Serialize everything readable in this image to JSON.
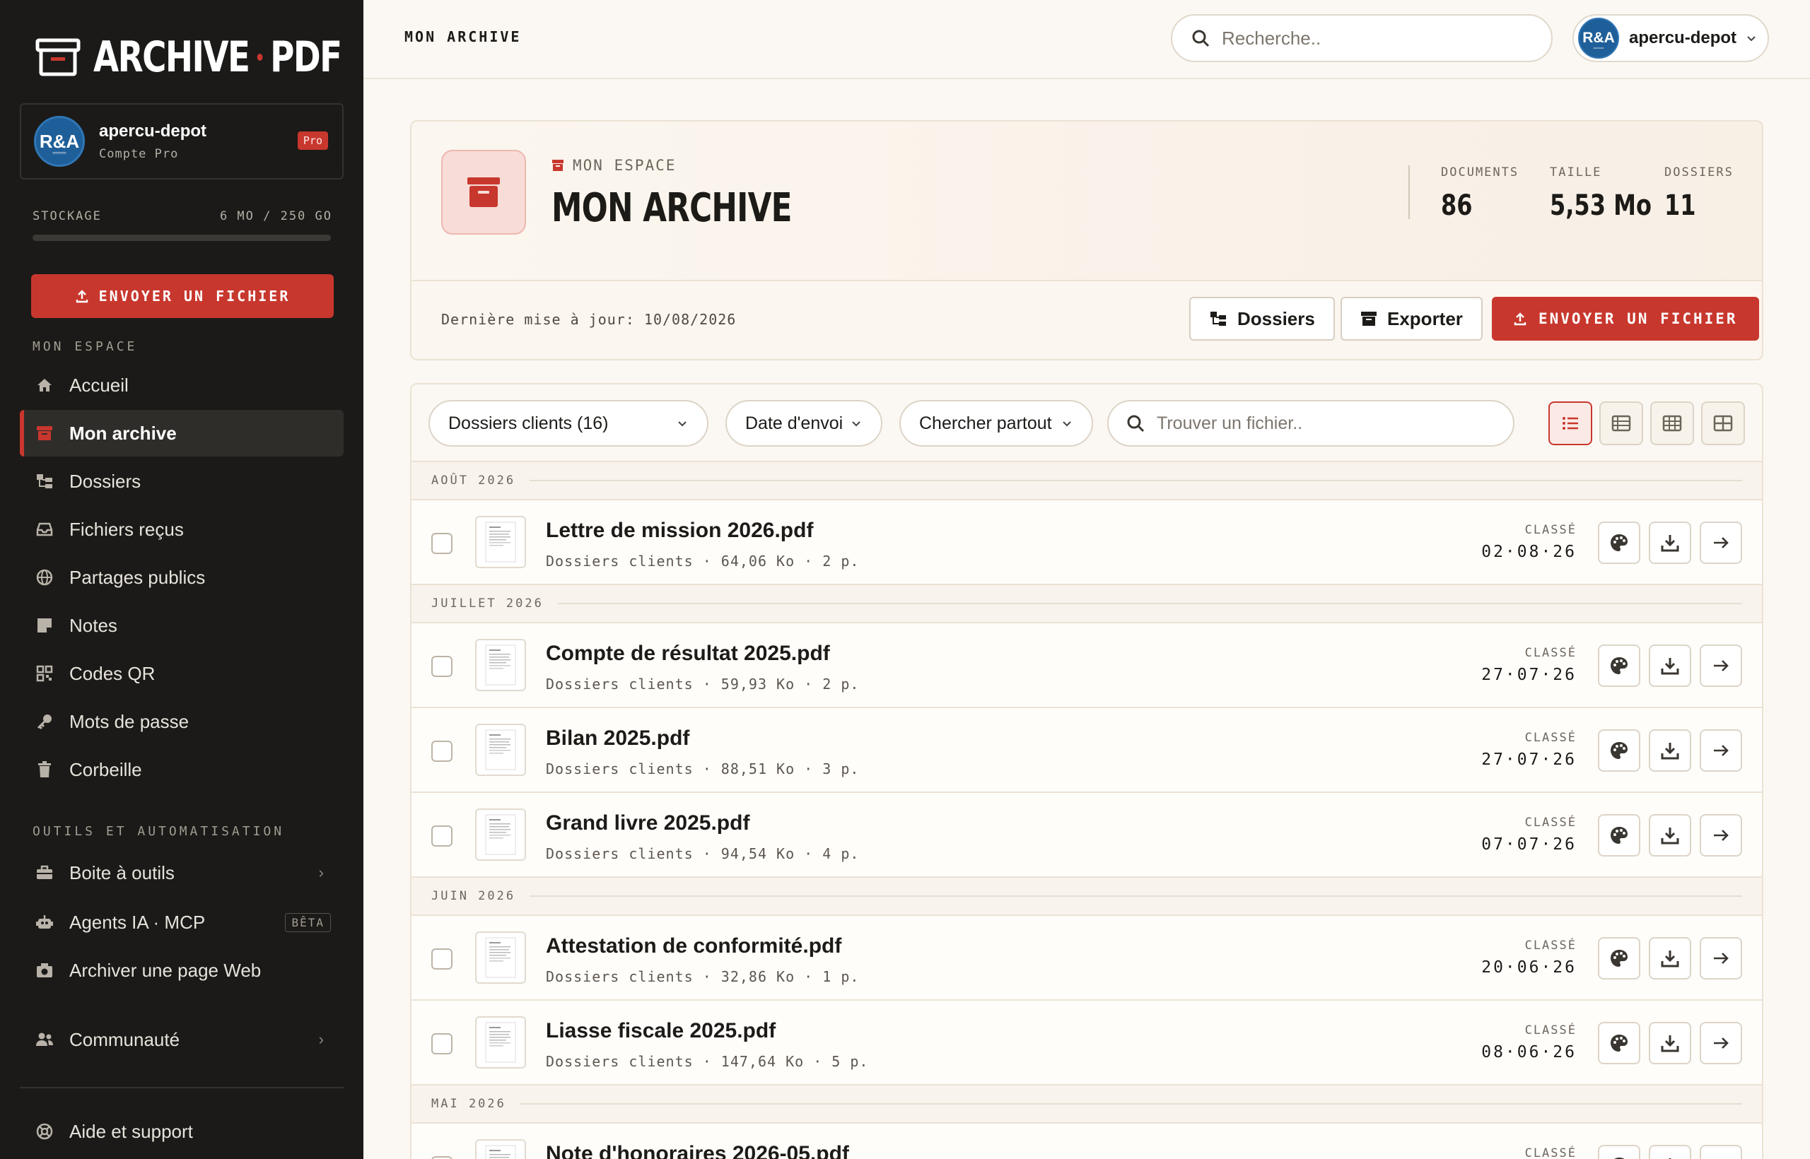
{
  "brand": {
    "name_left": "ARCHIVE",
    "name_right": "PDF"
  },
  "account": {
    "initials": "R&A",
    "name": "apercu-depot",
    "plan": "Compte Pro",
    "badge": "Pro"
  },
  "storage": {
    "label": "STOCKAGE",
    "value": "6 MO / 250 GO",
    "used_fraction": 2e-05
  },
  "sidebar": {
    "upload_label": "ENVOYER UN FICHIER",
    "section1": "MON ESPACE",
    "items": [
      {
        "label": "Accueil",
        "icon": "home-icon"
      },
      {
        "label": "Mon archive",
        "icon": "archive-icon",
        "active": true
      },
      {
        "label": "Dossiers",
        "icon": "folder-tree-icon"
      },
      {
        "label": "Fichiers reçus",
        "icon": "inbox-icon"
      },
      {
        "label": "Partages publics",
        "icon": "globe-icon"
      },
      {
        "label": "Notes",
        "icon": "note-icon"
      },
      {
        "label": "Codes QR",
        "icon": "qr-icon"
      },
      {
        "label": "Mots de passe",
        "icon": "key-icon"
      },
      {
        "label": "Corbeille",
        "icon": "trash-icon"
      }
    ],
    "section2": "OUTILS ET AUTOMATISATION",
    "tools": [
      {
        "label": "Boite à outils",
        "icon": "toolbox-icon"
      },
      {
        "label": "Agents IA · MCP",
        "icon": "robot-icon",
        "badge": "BÊTA"
      },
      {
        "label": "Archiver une page Web",
        "icon": "camera-icon"
      }
    ],
    "community": "Communauté",
    "help": "Aide et support"
  },
  "topbar": {
    "breadcrumb": "MON ARCHIVE",
    "search_placeholder": "Recherche..",
    "user": "apercu-depot",
    "user_initials": "R&A"
  },
  "hero": {
    "subtitle": "MON ESPACE",
    "title": "MON ARCHIVE",
    "stats": [
      {
        "label": "DOCUMENTS",
        "value": "86"
      },
      {
        "label": "TAILLE",
        "value": "5,53 Mo"
      },
      {
        "label": "DOSSIERS",
        "value": "11"
      }
    ],
    "updated": "Dernière mise à jour: 10/08/2026",
    "btn_folders": "Dossiers",
    "btn_export": "Exporter",
    "btn_upload": "ENVOYER UN FICHIER"
  },
  "filters": {
    "folder": "Dossiers clients (16)",
    "sort": "Date d'envoi",
    "scope": "Chercher partout",
    "find_placeholder": "Trouver un fichier.."
  },
  "classed_label": "CLASSÉ",
  "groups": [
    {
      "label": "AOÛT 2026",
      "files": [
        {
          "name": "Lettre de mission 2026.pdf",
          "meta": "Dossiers clients · 64,06 Ko · 2 p.",
          "date": "02·08·26"
        }
      ]
    },
    {
      "label": "JUILLET 2026",
      "files": [
        {
          "name": "Compte de résultat 2025.pdf",
          "meta": "Dossiers clients · 59,93 Ko · 2 p.",
          "date": "27·07·26"
        },
        {
          "name": "Bilan 2025.pdf",
          "meta": "Dossiers clients · 88,51 Ko · 3 p.",
          "date": "27·07·26"
        },
        {
          "name": "Grand livre 2025.pdf",
          "meta": "Dossiers clients · 94,54 Ko · 4 p.",
          "date": "07·07·26"
        }
      ]
    },
    {
      "label": "JUIN 2026",
      "files": [
        {
          "name": "Attestation de conformité.pdf",
          "meta": "Dossiers clients · 32,86 Ko · 1 p.",
          "date": "20·06·26"
        },
        {
          "name": "Liasse fiscale 2025.pdf",
          "meta": "Dossiers clients · 147,64 Ko · 5 p.",
          "date": "08·06·26"
        }
      ]
    },
    {
      "label": "MAI 2026",
      "files": [
        {
          "name": "Note d'honoraires 2026-05.pdf",
          "meta": "",
          "date": ""
        }
      ]
    }
  ],
  "colors": {
    "accent": "#c8372d",
    "sidebar_bg": "#1b1a18",
    "page_bg": "#fbf8f3"
  }
}
